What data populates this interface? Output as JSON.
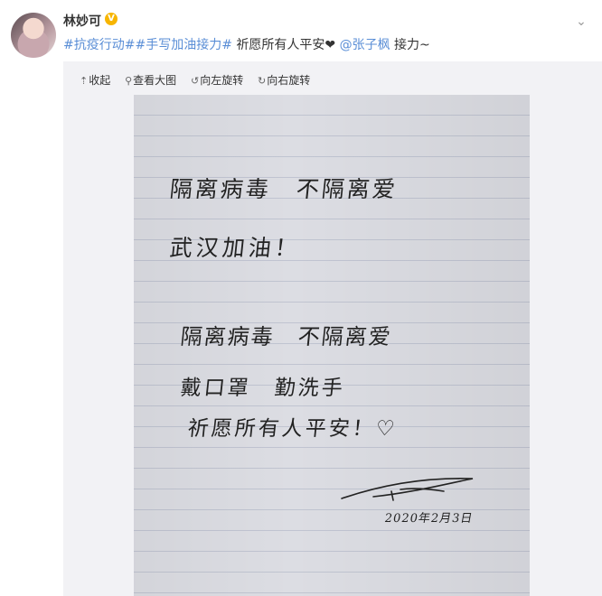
{
  "post": {
    "username": "林妙可",
    "verified_badge": "V",
    "text_parts": {
      "hashtag1": "#抗疫行动#",
      "hashtag2": "#手写加油接力#",
      "body": " 祈愿所有人平安",
      "heart": "❤",
      "mention": "@张子枫",
      "tail": " 接力~"
    }
  },
  "toolbar": {
    "collapse_label": "收起",
    "view_large_label": "查看大图",
    "rotate_left_label": "向左旋转",
    "rotate_right_label": "向右旋转"
  },
  "icons": {
    "collapse": "collapse-icon",
    "magnifier": "magnifier-icon",
    "rotate_left": "rotate-left-icon",
    "rotate_right": "rotate-right-icon",
    "menu": "chevron-down-icon"
  },
  "handwriting": {
    "line1": "隔离病毒　不隔离爱",
    "line2": "武汉加油！",
    "line3": "隔离病毒　不隔离爱",
    "line4": "戴口罩　勤洗手",
    "line5": "祈愿所有人平安！♡",
    "date": "2020年2月3日"
  },
  "colors": {
    "link": "#5a8ed6",
    "badge": "#f7b500",
    "media_bg": "#f2f2f5"
  }
}
